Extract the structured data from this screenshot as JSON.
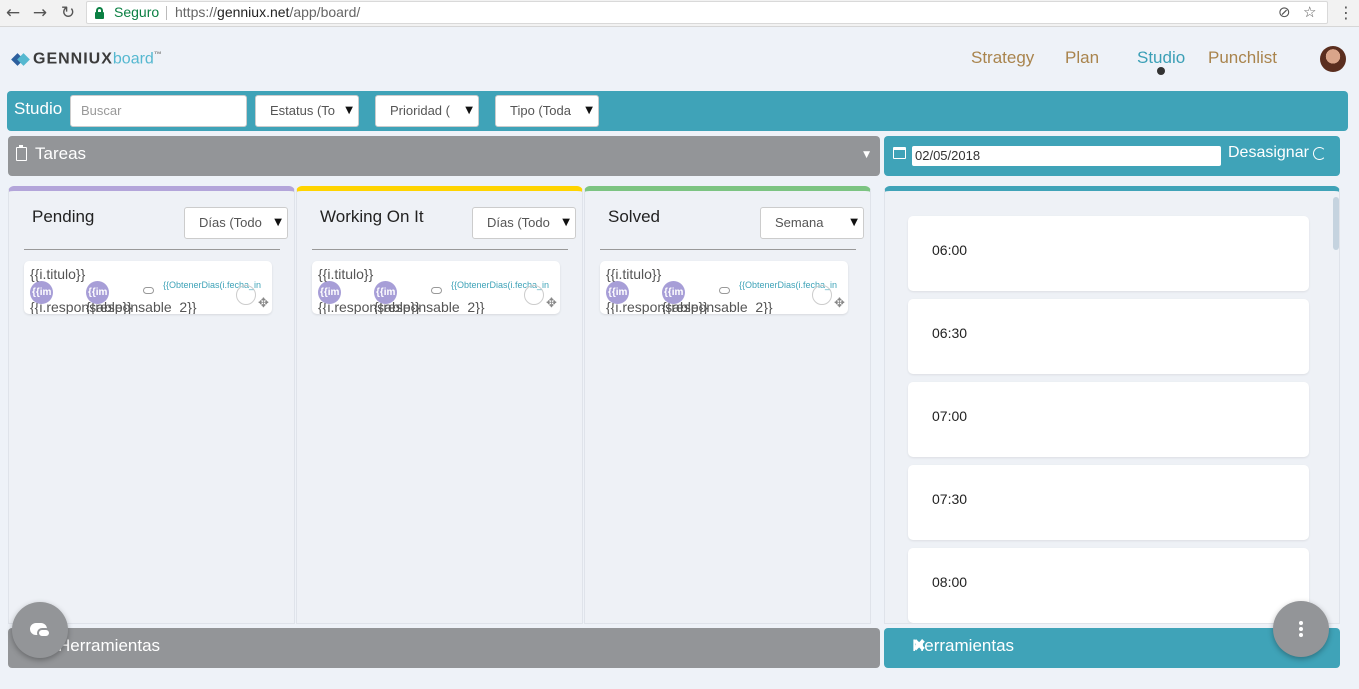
{
  "browser": {
    "secure_label": "Seguro",
    "url_scheme": "https://",
    "url_host": "genniux.net",
    "url_path": "/app/board/"
  },
  "logo": {
    "main": "GENNIUX",
    "accent": "board",
    "tm": "™"
  },
  "nav": {
    "items": [
      "Strategy",
      "Plan",
      "Studio",
      "Punchlist"
    ],
    "active": "Studio"
  },
  "filters": {
    "title": "Studio",
    "search_placeholder": "Buscar",
    "selects": [
      "Estatus (To",
      "Prioridad (",
      "Tipo (Toda"
    ]
  },
  "tasks_panel": {
    "title": "Tareas"
  },
  "date_panel": {
    "date": "02/05/2018",
    "unassign_label": "Desasignar"
  },
  "columns": [
    {
      "title": "Pending",
      "filter": "Días (Todo",
      "color": "#b3a5da"
    },
    {
      "title": "Working On It",
      "filter": "Días (Todo",
      "color": "#ffd400"
    },
    {
      "title": "Solved",
      "filter": "Semana",
      "color": "#7cc482"
    }
  ],
  "card_template": {
    "title": "{{i.titulo}}",
    "responsable": "{{i.responsable}}",
    "responsable2": "{{responsable_2}}",
    "badge": "{{im",
    "date": "{{ObtenerDias(i.fecha_in"
  },
  "schedule": {
    "slots": [
      "06:00",
      "06:30",
      "07:00",
      "07:30",
      "08:00"
    ]
  },
  "footer": {
    "tools_left": "Herramientas",
    "tools_right": "Herramientas"
  },
  "colors": {
    "teal": "#3fa3b8",
    "gray": "#939598",
    "nav_link": "#a9844d"
  }
}
